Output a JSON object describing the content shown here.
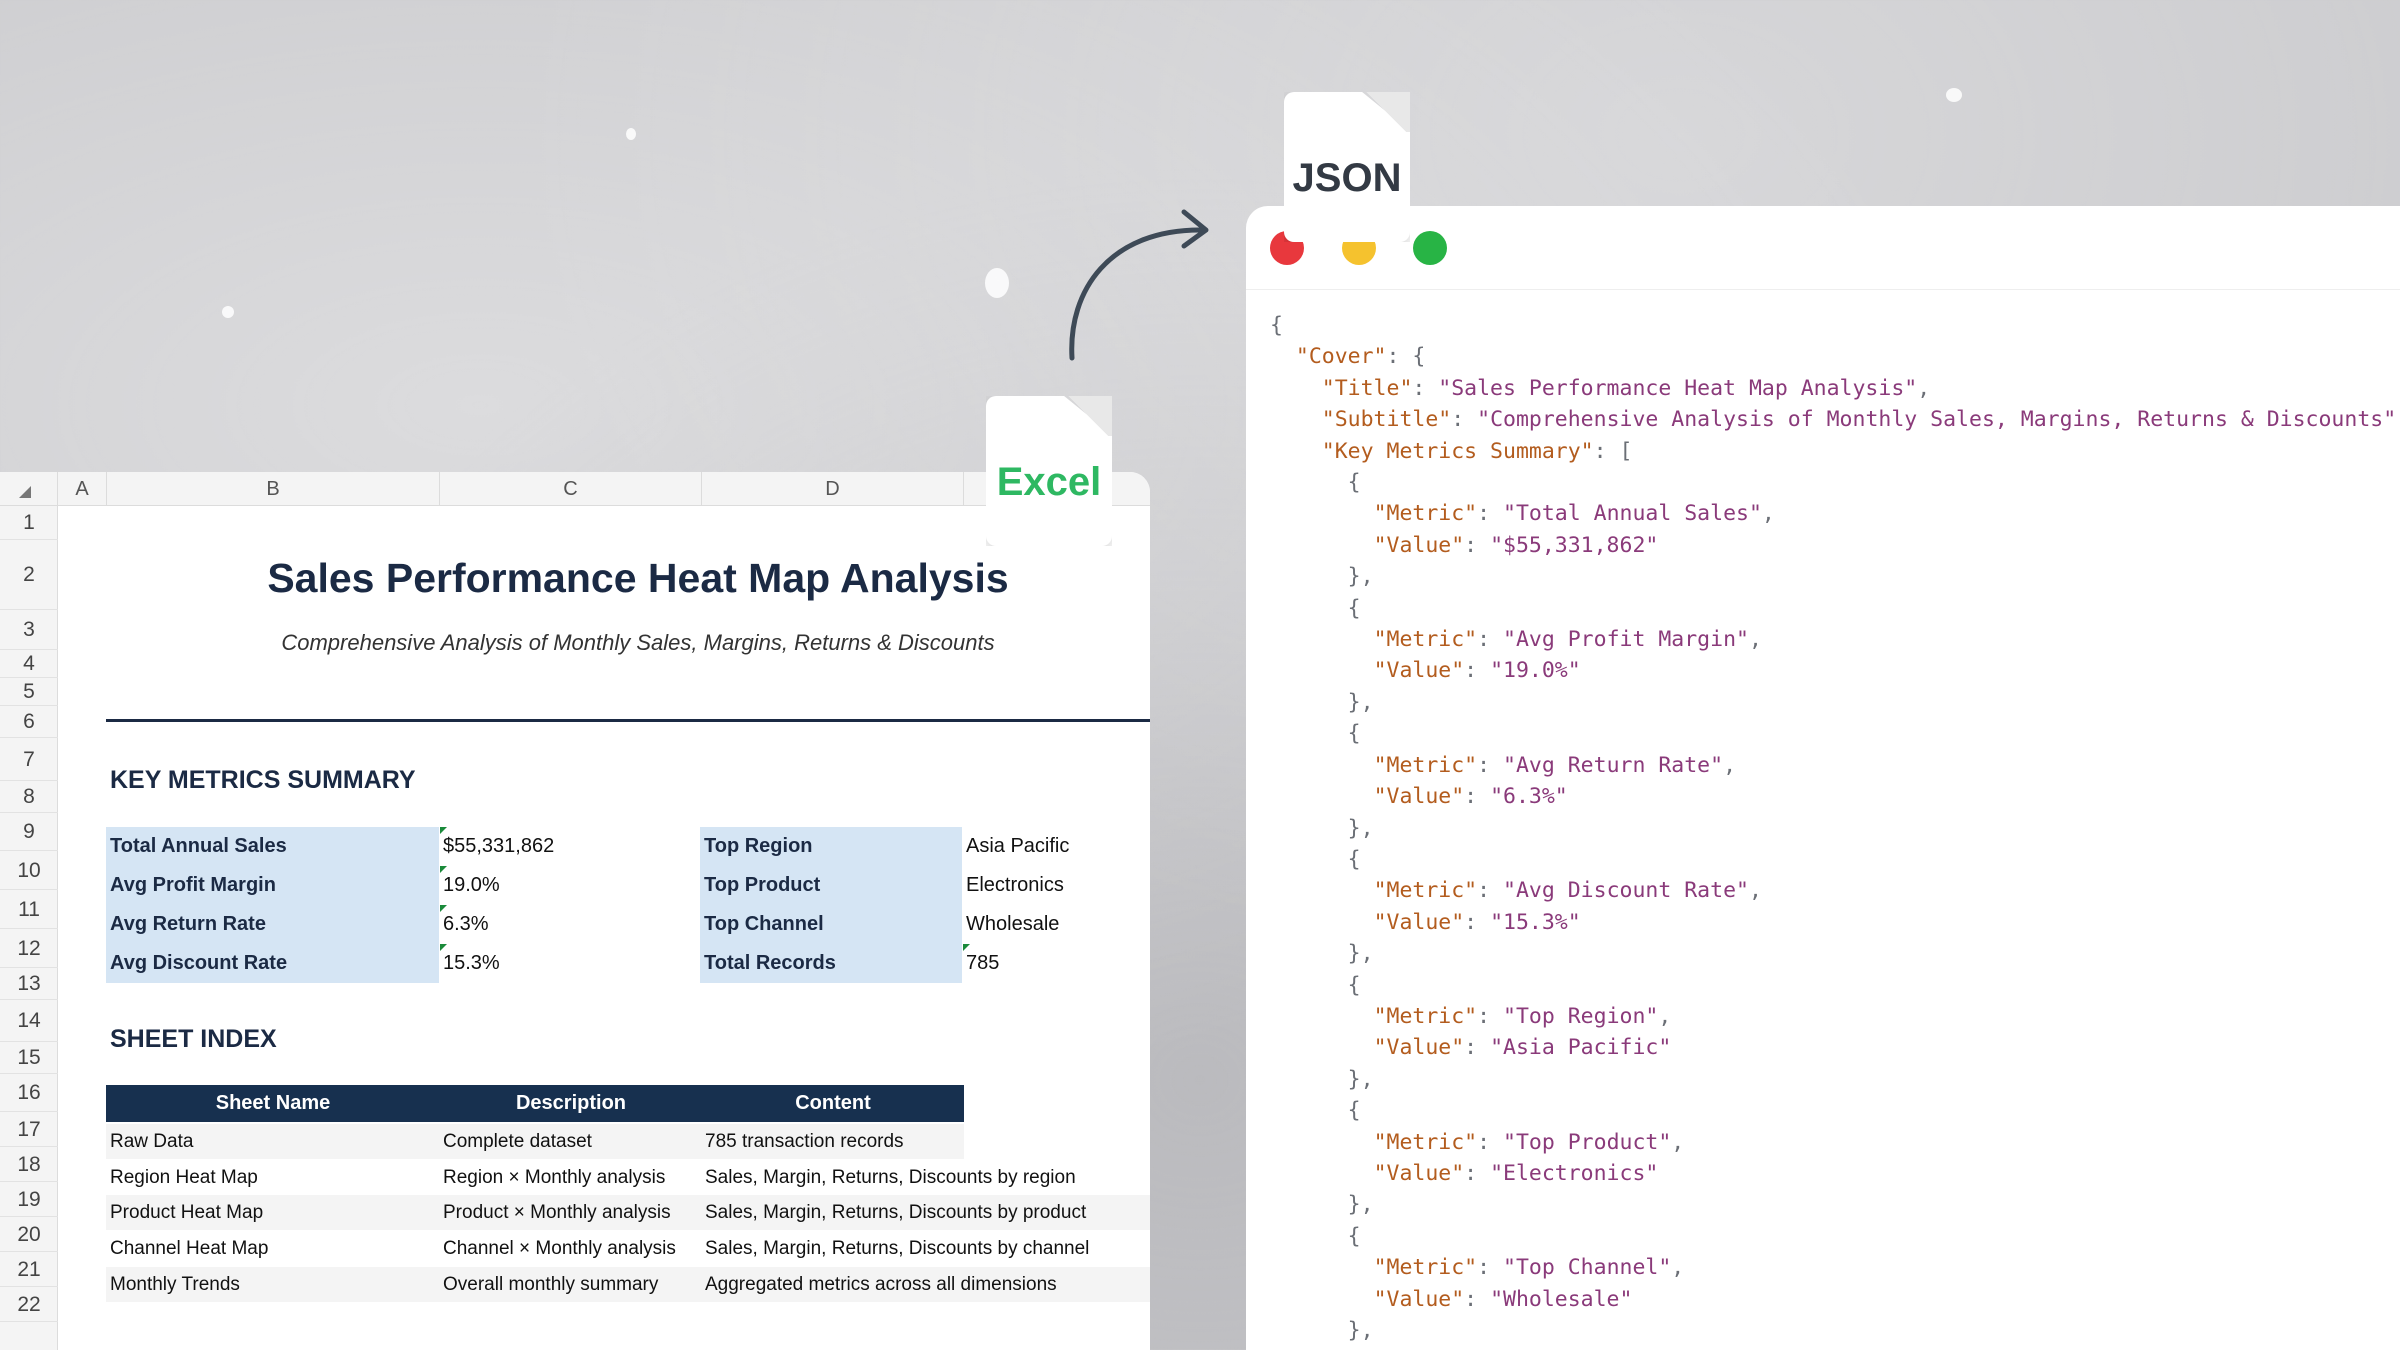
{
  "badges": {
    "excel": "Excel",
    "json": "JSON"
  },
  "spreadsheet": {
    "columns": [
      "A",
      "B",
      "C",
      "D"
    ],
    "rows": [
      "1",
      "2",
      "3",
      "4",
      "5",
      "6",
      "7",
      "8",
      "9",
      "10",
      "11",
      "12",
      "13",
      "14",
      "15",
      "16",
      "17",
      "18",
      "19",
      "20",
      "21",
      "22"
    ],
    "title": "Sales Performance Heat Map Analysis",
    "subtitle": "Comprehensive Analysis of Monthly Sales, Margins, Returns & Discounts",
    "key_metrics_heading": "KEY METRICS SUMMARY",
    "left_metrics": [
      {
        "label": "Total Annual Sales",
        "value": "$55,331,862"
      },
      {
        "label": "Avg Profit Margin",
        "value": "19.0%"
      },
      {
        "label": "Avg Return Rate",
        "value": "6.3%"
      },
      {
        "label": "Avg Discount Rate",
        "value": "15.3%"
      }
    ],
    "right_metrics": [
      {
        "label": "Top Region",
        "value": "Asia Pacific"
      },
      {
        "label": "Top Product",
        "value": "Electronics"
      },
      {
        "label": "Top Channel",
        "value": "Wholesale"
      },
      {
        "label": "Total Records",
        "value": "785"
      }
    ],
    "sheet_index_heading": "SHEET INDEX",
    "index_headers": [
      "Sheet Name",
      "Description",
      "Content"
    ],
    "index_rows": [
      [
        "Raw Data",
        "Complete dataset",
        "785 transaction records"
      ],
      [
        "Region Heat Map",
        "Region × Monthly analysis",
        "Sales, Margin, Returns, Discounts by region"
      ],
      [
        "Product Heat Map",
        "Product × Monthly analysis",
        "Sales, Margin, Returns, Discounts by product"
      ],
      [
        "Channel Heat Map",
        "Channel × Monthly analysis",
        "Sales, Margin, Returns, Discounts by channel"
      ],
      [
        "Monthly Trends",
        "Overall monthly summary",
        "Aggregated metrics across all dimensions"
      ]
    ]
  },
  "json_view": {
    "window_buttons": {
      "close": "#e8383d",
      "minimize": "#f5c22e",
      "zoom": "#28b445"
    },
    "keys": {
      "cover": "\"Cover\"",
      "title": "\"Title\"",
      "subtitle": "\"Subtitle\"",
      "key_metrics": "\"Key Metrics Summary\"",
      "metric": "\"Metric\"",
      "value": "\"Value\""
    },
    "title_value": "\"Sales Performance Heat Map Analysis\"",
    "subtitle_value": "\"Comprehensive Analysis of Monthly Sales, Margins, Returns & Discounts\"",
    "entries": [
      {
        "metric": "\"Total Annual Sales\"",
        "value": "\"$55,331,862\""
      },
      {
        "metric": "\"Avg Profit Margin\"",
        "value": "\"19.0%\""
      },
      {
        "metric": "\"Avg Return Rate\"",
        "value": "\"6.3%\""
      },
      {
        "metric": "\"Avg Discount Rate\"",
        "value": "\"15.3%\""
      },
      {
        "metric": "\"Top Region\"",
        "value": "\"Asia Pacific\""
      },
      {
        "metric": "\"Top Product\"",
        "value": "\"Electronics\""
      },
      {
        "metric": "\"Top Channel\"",
        "value": "\"Wholesale\""
      }
    ]
  }
}
